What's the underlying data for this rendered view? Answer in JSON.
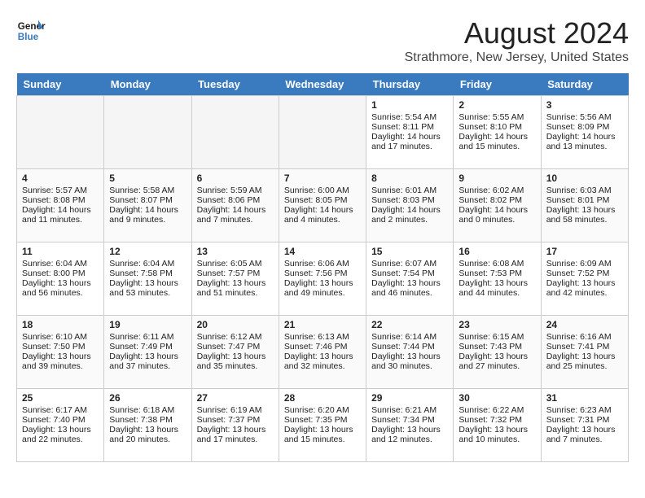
{
  "logo": {
    "line1": "General",
    "line2": "Blue"
  },
  "title": "August 2024",
  "subtitle": "Strathmore, New Jersey, United States",
  "days": [
    "Sunday",
    "Monday",
    "Tuesday",
    "Wednesday",
    "Thursday",
    "Friday",
    "Saturday"
  ],
  "weeks": [
    [
      {
        "date": "",
        "content": "",
        "empty": true
      },
      {
        "date": "",
        "content": "",
        "empty": true
      },
      {
        "date": "",
        "content": "",
        "empty": true
      },
      {
        "date": "",
        "content": "",
        "empty": true
      },
      {
        "date": "1",
        "sunrise": "Sunrise: 5:54 AM",
        "sunset": "Sunset: 8:11 PM",
        "daylight": "Daylight: 14 hours and 17 minutes."
      },
      {
        "date": "2",
        "sunrise": "Sunrise: 5:55 AM",
        "sunset": "Sunset: 8:10 PM",
        "daylight": "Daylight: 14 hours and 15 minutes."
      },
      {
        "date": "3",
        "sunrise": "Sunrise: 5:56 AM",
        "sunset": "Sunset: 8:09 PM",
        "daylight": "Daylight: 14 hours and 13 minutes."
      }
    ],
    [
      {
        "date": "4",
        "sunrise": "Sunrise: 5:57 AM",
        "sunset": "Sunset: 8:08 PM",
        "daylight": "Daylight: 14 hours and 11 minutes."
      },
      {
        "date": "5",
        "sunrise": "Sunrise: 5:58 AM",
        "sunset": "Sunset: 8:07 PM",
        "daylight": "Daylight: 14 hours and 9 minutes."
      },
      {
        "date": "6",
        "sunrise": "Sunrise: 5:59 AM",
        "sunset": "Sunset: 8:06 PM",
        "daylight": "Daylight: 14 hours and 7 minutes."
      },
      {
        "date": "7",
        "sunrise": "Sunrise: 6:00 AM",
        "sunset": "Sunset: 8:05 PM",
        "daylight": "Daylight: 14 hours and 4 minutes."
      },
      {
        "date": "8",
        "sunrise": "Sunrise: 6:01 AM",
        "sunset": "Sunset: 8:03 PM",
        "daylight": "Daylight: 14 hours and 2 minutes."
      },
      {
        "date": "9",
        "sunrise": "Sunrise: 6:02 AM",
        "sunset": "Sunset: 8:02 PM",
        "daylight": "Daylight: 14 hours and 0 minutes."
      },
      {
        "date": "10",
        "sunrise": "Sunrise: 6:03 AM",
        "sunset": "Sunset: 8:01 PM",
        "daylight": "Daylight: 13 hours and 58 minutes."
      }
    ],
    [
      {
        "date": "11",
        "sunrise": "Sunrise: 6:04 AM",
        "sunset": "Sunset: 8:00 PM",
        "daylight": "Daylight: 13 hours and 56 minutes."
      },
      {
        "date": "12",
        "sunrise": "Sunrise: 6:04 AM",
        "sunset": "Sunset: 7:58 PM",
        "daylight": "Daylight: 13 hours and 53 minutes."
      },
      {
        "date": "13",
        "sunrise": "Sunrise: 6:05 AM",
        "sunset": "Sunset: 7:57 PM",
        "daylight": "Daylight: 13 hours and 51 minutes."
      },
      {
        "date": "14",
        "sunrise": "Sunrise: 6:06 AM",
        "sunset": "Sunset: 7:56 PM",
        "daylight": "Daylight: 13 hours and 49 minutes."
      },
      {
        "date": "15",
        "sunrise": "Sunrise: 6:07 AM",
        "sunset": "Sunset: 7:54 PM",
        "daylight": "Daylight: 13 hours and 46 minutes."
      },
      {
        "date": "16",
        "sunrise": "Sunrise: 6:08 AM",
        "sunset": "Sunset: 7:53 PM",
        "daylight": "Daylight: 13 hours and 44 minutes."
      },
      {
        "date": "17",
        "sunrise": "Sunrise: 6:09 AM",
        "sunset": "Sunset: 7:52 PM",
        "daylight": "Daylight: 13 hours and 42 minutes."
      }
    ],
    [
      {
        "date": "18",
        "sunrise": "Sunrise: 6:10 AM",
        "sunset": "Sunset: 7:50 PM",
        "daylight": "Daylight: 13 hours and 39 minutes."
      },
      {
        "date": "19",
        "sunrise": "Sunrise: 6:11 AM",
        "sunset": "Sunset: 7:49 PM",
        "daylight": "Daylight: 13 hours and 37 minutes."
      },
      {
        "date": "20",
        "sunrise": "Sunrise: 6:12 AM",
        "sunset": "Sunset: 7:47 PM",
        "daylight": "Daylight: 13 hours and 35 minutes."
      },
      {
        "date": "21",
        "sunrise": "Sunrise: 6:13 AM",
        "sunset": "Sunset: 7:46 PM",
        "daylight": "Daylight: 13 hours and 32 minutes."
      },
      {
        "date": "22",
        "sunrise": "Sunrise: 6:14 AM",
        "sunset": "Sunset: 7:44 PM",
        "daylight": "Daylight: 13 hours and 30 minutes."
      },
      {
        "date": "23",
        "sunrise": "Sunrise: 6:15 AM",
        "sunset": "Sunset: 7:43 PM",
        "daylight": "Daylight: 13 hours and 27 minutes."
      },
      {
        "date": "24",
        "sunrise": "Sunrise: 6:16 AM",
        "sunset": "Sunset: 7:41 PM",
        "daylight": "Daylight: 13 hours and 25 minutes."
      }
    ],
    [
      {
        "date": "25",
        "sunrise": "Sunrise: 6:17 AM",
        "sunset": "Sunset: 7:40 PM",
        "daylight": "Daylight: 13 hours and 22 minutes."
      },
      {
        "date": "26",
        "sunrise": "Sunrise: 6:18 AM",
        "sunset": "Sunset: 7:38 PM",
        "daylight": "Daylight: 13 hours and 20 minutes."
      },
      {
        "date": "27",
        "sunrise": "Sunrise: 6:19 AM",
        "sunset": "Sunset: 7:37 PM",
        "daylight": "Daylight: 13 hours and 17 minutes."
      },
      {
        "date": "28",
        "sunrise": "Sunrise: 6:20 AM",
        "sunset": "Sunset: 7:35 PM",
        "daylight": "Daylight: 13 hours and 15 minutes."
      },
      {
        "date": "29",
        "sunrise": "Sunrise: 6:21 AM",
        "sunset": "Sunset: 7:34 PM",
        "daylight": "Daylight: 13 hours and 12 minutes."
      },
      {
        "date": "30",
        "sunrise": "Sunrise: 6:22 AM",
        "sunset": "Sunset: 7:32 PM",
        "daylight": "Daylight: 13 hours and 10 minutes."
      },
      {
        "date": "31",
        "sunrise": "Sunrise: 6:23 AM",
        "sunset": "Sunset: 7:31 PM",
        "daylight": "Daylight: 13 hours and 7 minutes."
      }
    ]
  ]
}
